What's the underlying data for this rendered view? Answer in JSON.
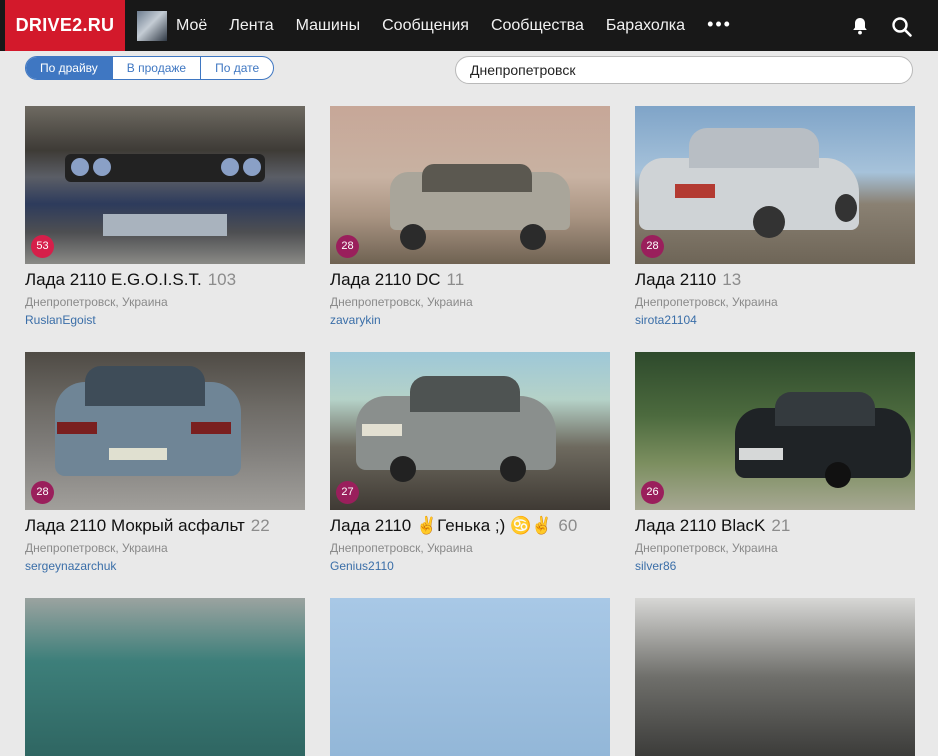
{
  "header": {
    "logo": "DRIVE2.RU",
    "nav": [
      "Моё",
      "Лента",
      "Машины",
      "Сообщения",
      "Сообщества",
      "Барахолка"
    ],
    "more": "•••",
    "icons": [
      "bell-icon",
      "search-icon"
    ]
  },
  "filters": {
    "tabs": [
      "По драйву",
      "В продаже",
      "По дате"
    ],
    "active_tab": "По драйву",
    "city_value": "Днепропетровск"
  },
  "colors": {
    "brand": "#d3192b",
    "tab_accent": "#3f77c2",
    "badge_red": "#d61f4a",
    "badge_purple": "#9a1f5c"
  },
  "cars": [
    {
      "title": "Лада 2110 E.G.O.I.S.T.",
      "count": "103",
      "location": "Днепропетровск, Украина",
      "owner": "RuslanEgoist",
      "badge": "53",
      "badge_color": "#d61f4a"
    },
    {
      "title": "Лада 2110 DC",
      "count": "11",
      "location": "Днепропетровск, Украина",
      "owner": "zavarykin",
      "badge": "28",
      "badge_color": "#9a1f5c"
    },
    {
      "title": "Лада 2110",
      "count": "13",
      "location": "Днепропетровск, Украина",
      "owner": "sirota21104",
      "badge": "28",
      "badge_color": "#9a1f5c"
    },
    {
      "title": "Лада 2110 Мокрый асфальт",
      "count": "22",
      "location": "Днепропетровск, Украина",
      "owner": "sergeynazarchuk",
      "badge": "28",
      "badge_color": "#9a1f5c"
    },
    {
      "title": "Лада 2110 ✌Генька ;) ♋✌",
      "count": "60",
      "location": "Днепропетровск, Украина",
      "owner": "Genius2110",
      "badge": "27",
      "badge_color": "#9a1f5c"
    },
    {
      "title": "Лада 2110 BlacK",
      "count": "21",
      "location": "Днепропетровск, Украина",
      "owner": "silver86",
      "badge": "26",
      "badge_color": "#9a1f5c"
    }
  ]
}
